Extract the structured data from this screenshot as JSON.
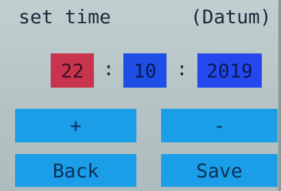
{
  "header": {
    "title": "set time",
    "subtitle": "(Datum)"
  },
  "date": {
    "day": "22",
    "separator_1": ":",
    "month": "10",
    "separator_2": ":",
    "year": "2019"
  },
  "buttons": {
    "increment_label": "+",
    "decrement_label": "-",
    "back_label": "Back",
    "save_label": "Save"
  },
  "colors": {
    "background": "#b9c6c8",
    "day_field": "#c8334e",
    "month_field": "#1e4ee6",
    "year_field": "#2448ee",
    "button": "#1a9ee8"
  }
}
